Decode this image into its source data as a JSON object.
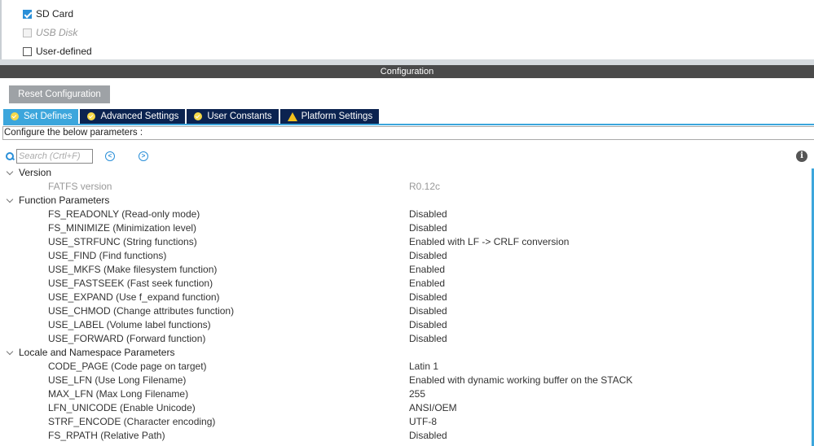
{
  "modes": [
    {
      "label": "SD Card",
      "checked": true,
      "disabled": false
    },
    {
      "label": "USB Disk",
      "checked": false,
      "disabled": true
    },
    {
      "label": "User-defined",
      "checked": false,
      "disabled": false
    }
  ],
  "configuration": {
    "title": "Configuration",
    "reset_label": "Reset Configuration",
    "tabs": [
      {
        "label": "Set Defines",
        "icon": "check-circle-icon",
        "active": true
      },
      {
        "label": "Advanced Settings",
        "icon": "check-circle-icon",
        "active": false
      },
      {
        "label": "User Constants",
        "icon": "check-circle-icon",
        "active": false
      },
      {
        "label": "Platform Settings",
        "icon": "warning-icon",
        "active": false
      }
    ],
    "description": "Configure the below parameters :",
    "search": {
      "placeholder": "Search (Crtl+F)",
      "value": ""
    },
    "info_icon": "i"
  },
  "tree": [
    {
      "group": "Version",
      "params": [
        {
          "name": "FATFS version",
          "value": "R0.12c",
          "readonly": true
        }
      ]
    },
    {
      "group": "Function Parameters",
      "params": [
        {
          "name": "FS_READONLY (Read-only mode)",
          "value": "Disabled"
        },
        {
          "name": "FS_MINIMIZE (Minimization level)",
          "value": "Disabled"
        },
        {
          "name": "USE_STRFUNC (String functions)",
          "value": "Enabled with LF -> CRLF conversion"
        },
        {
          "name": "USE_FIND (Find functions)",
          "value": "Disabled"
        },
        {
          "name": "USE_MKFS (Make filesystem function)",
          "value": "Enabled"
        },
        {
          "name": "USE_FASTSEEK (Fast seek function)",
          "value": "Enabled"
        },
        {
          "name": "USE_EXPAND (Use f_expand function)",
          "value": "Disabled"
        },
        {
          "name": "USE_CHMOD (Change attributes function)",
          "value": "Disabled"
        },
        {
          "name": "USE_LABEL (Volume label functions)",
          "value": "Disabled"
        },
        {
          "name": "USE_FORWARD (Forward function)",
          "value": "Disabled"
        }
      ]
    },
    {
      "group": "Locale and Namespace Parameters",
      "params": [
        {
          "name": "CODE_PAGE (Code page on target)",
          "value": "Latin 1"
        },
        {
          "name": "USE_LFN (Use Long Filename)",
          "value": "Enabled with dynamic working buffer on the STACK"
        },
        {
          "name": "MAX_LFN (Max Long Filename)",
          "value": "255"
        },
        {
          "name": "LFN_UNICODE (Enable Unicode)",
          "value": "ANSI/OEM"
        },
        {
          "name": "STRF_ENCODE (Character encoding)",
          "value": "UTF-8"
        },
        {
          "name": "FS_RPATH (Relative Path)",
          "value": "Disabled"
        }
      ]
    }
  ]
}
